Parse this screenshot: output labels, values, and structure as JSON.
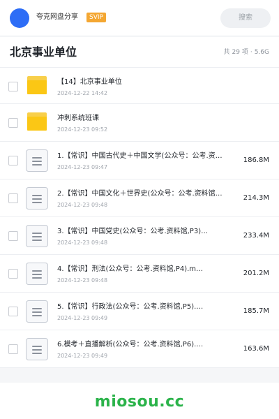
{
  "header": {
    "app_title": "夸克网盘分享",
    "badge": "SVIP",
    "search_placeholder": "搜索"
  },
  "folder": {
    "name": "北京事业单位",
    "item_count": "共 29 项",
    "separator": "·",
    "total_size": "5.6G"
  },
  "files": [
    {
      "type": "folder",
      "name": "【14】北京事业单位",
      "date": "2024-12-22 14:42",
      "size": ""
    },
    {
      "type": "folder",
      "name": "冲刺系统班课",
      "date": "2024-12-23 09:52",
      "size": ""
    },
    {
      "type": "file",
      "name": "1.【常识】中国古代史＋中国文学(公众号：公考.资…",
      "date": "2024-12-23 09:47",
      "size": "186.8M"
    },
    {
      "type": "file",
      "name": "2.【常识】中国文化＋世界史(公众号：公考.资料馆…",
      "date": "2024-12-23 09:48",
      "size": "214.3M"
    },
    {
      "type": "file",
      "name": "3.【常识】中国党史(公众号：公考.资料馆,P3)…",
      "date": "2024-12-23 09:48",
      "size": "233.4M"
    },
    {
      "type": "file",
      "name": "4.【常识】刑法(公众号：公考.资料馆,P4).m…",
      "date": "2024-12-23 09:48",
      "size": "201.2M"
    },
    {
      "type": "file",
      "name": "5.【常识】行政法(公众号：公考.资料馆,P5).…",
      "date": "2024-12-23 09:49",
      "size": "185.7M"
    },
    {
      "type": "file",
      "name": "6.模考＋直播解析(公众号：公考.资料馆,P6).…",
      "date": "2024-12-23 09:49",
      "size": "163.6M"
    }
  ],
  "watermark": "miosou.cc",
  "colors": {
    "avatar": "#2d6df6",
    "badge": "#f4a732",
    "folder_icon": "#fbc715",
    "watermark": "#2bb34a"
  }
}
